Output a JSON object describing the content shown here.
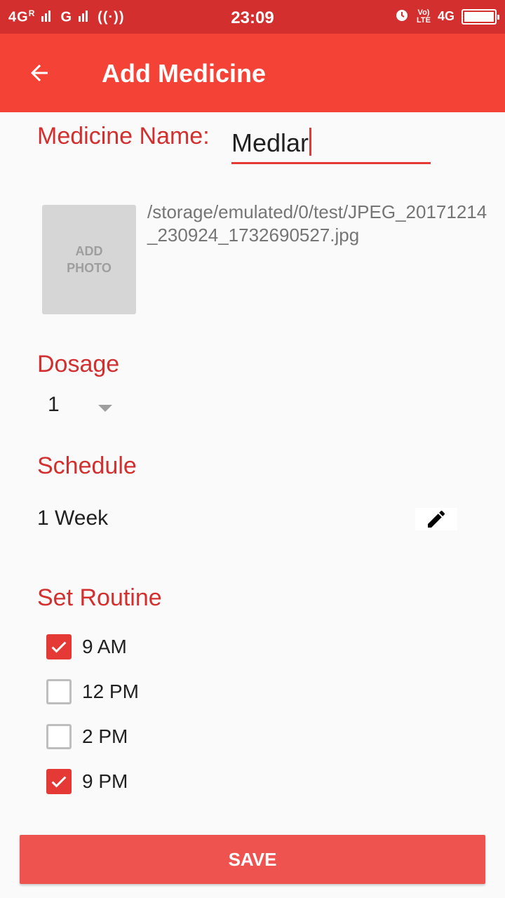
{
  "status_bar": {
    "network1": "4G",
    "roaming": "R",
    "network2": "G",
    "time": "23:09",
    "volte_top": "Vo)",
    "volte_bottom": "LTE",
    "network3": "4G"
  },
  "app_bar": {
    "title": "Add Medicine"
  },
  "form": {
    "medicine_name_label": "Medicine Name:",
    "medicine_name_value": "Medlar",
    "photo_placeholder": "ADD\nPHOTO",
    "photo_path": "/storage/emulated/0/test/JPEG_20171214_230924_1732690527.jpg",
    "dosage_label": "Dosage",
    "dosage_value": "1",
    "schedule_label": "Schedule",
    "schedule_value": "1 Week",
    "routine_label": "Set Routine",
    "routine": [
      {
        "label": "9 AM",
        "checked": true
      },
      {
        "label": "12 PM",
        "checked": false
      },
      {
        "label": "2 PM",
        "checked": false
      },
      {
        "label": "9 PM",
        "checked": true
      }
    ],
    "save_label": "SAVE"
  },
  "colors": {
    "status_bar": "#d32f2f",
    "app_bar": "#f44336",
    "accent": "#e53935",
    "save_button": "#ef5350"
  }
}
